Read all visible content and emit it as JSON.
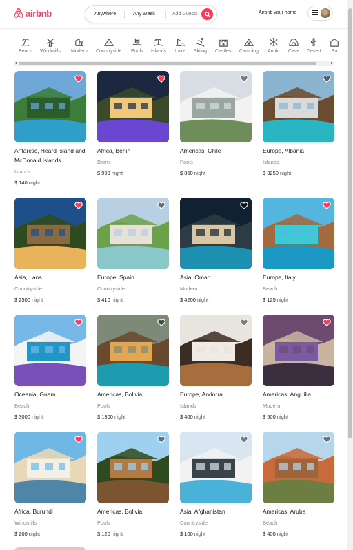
{
  "header": {
    "logo_text": "airbnb",
    "search": {
      "anywhere": "Anywhere",
      "any_week": "Any Week",
      "add_guests": "Add Guests"
    },
    "host_link": "Airbnb your home",
    "brand_color": "#ff385c"
  },
  "categories": [
    {
      "label": "Beach",
      "icon": "beach-icon"
    },
    {
      "label": "Windmills",
      "icon": "windmill-icon"
    },
    {
      "label": "Modern",
      "icon": "modern-house-icon"
    },
    {
      "label": "Countryside",
      "icon": "mountain-icon"
    },
    {
      "label": "Pools",
      "icon": "pool-icon"
    },
    {
      "label": "Islands",
      "icon": "island-icon"
    },
    {
      "label": "Lake",
      "icon": "lake-icon"
    },
    {
      "label": "Skiing",
      "icon": "skiing-icon"
    },
    {
      "label": "Castles",
      "icon": "castle-icon"
    },
    {
      "label": "Camping",
      "icon": "camping-icon"
    },
    {
      "label": "Arctic",
      "icon": "snowflake-icon"
    },
    {
      "label": "Cave",
      "icon": "cave-icon"
    },
    {
      "label": "Desert",
      "icon": "cactus-icon"
    },
    {
      "label": "Ba",
      "icon": "barn-icon"
    }
  ],
  "price_unit": "night",
  "listings": [
    {
      "title": "Antarctic, Heard Island and McDonald Islands",
      "category": "Islands",
      "price": "$ 140",
      "favorite": true
    },
    {
      "title": "Africa, Benin",
      "category": "Barns",
      "price": "$ 999",
      "favorite": true
    },
    {
      "title": "Americas, Chile",
      "category": "Pools",
      "price": "$ 860",
      "favorite": false
    },
    {
      "title": "Europe, Albania",
      "category": "Islands",
      "price": "$ 3250",
      "favorite": false
    },
    {
      "title": "Asia, Laos",
      "category": "Countryside",
      "price": "$ 2500",
      "favorite": true
    },
    {
      "title": "Europe, Spain",
      "category": "Countryside",
      "price": "$ 410",
      "favorite": false
    },
    {
      "title": "Asia, Oman",
      "category": "Modern",
      "price": "$ 4200",
      "favorite": false
    },
    {
      "title": "Europe, Italy",
      "category": "Beach",
      "price": "$ 125",
      "favorite": true
    },
    {
      "title": "Oceania, Guam",
      "category": "Beach",
      "price": "$ 3000",
      "favorite": true
    },
    {
      "title": "Americas, Bolivia",
      "category": "Pools",
      "price": "$ 1300",
      "favorite": false
    },
    {
      "title": "Europe, Andorra",
      "category": "Islands",
      "price": "$ 400",
      "favorite": false
    },
    {
      "title": "Americas, Anguilla",
      "category": "Modern",
      "price": "$ 500",
      "favorite": true
    },
    {
      "title": "Africa, Burundi",
      "category": "Windmills",
      "price": "$ 200",
      "favorite": true
    },
    {
      "title": "Americas, Bolivia",
      "category": "Pools",
      "price": "$ 120",
      "favorite": false
    },
    {
      "title": "Asia, Afghanistan",
      "category": "Countryside",
      "price": "$ 100",
      "favorite": false
    },
    {
      "title": "Americas, Aruba",
      "category": "Beach",
      "price": "$ 400",
      "favorite": false
    }
  ]
}
